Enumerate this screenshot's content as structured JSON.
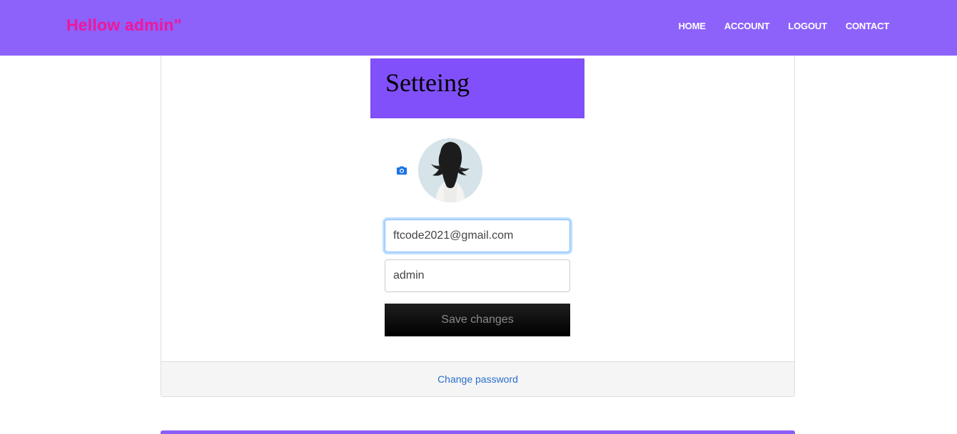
{
  "navbar": {
    "brand": "Hellow admin\"",
    "links": [
      {
        "label": "HOME"
      },
      {
        "label": "ACCOUNT"
      },
      {
        "label": "LOGOUT"
      },
      {
        "label": "CONTACT"
      }
    ],
    "background": "#8c62fb",
    "brand_color": "#f0179b"
  },
  "settings": {
    "title": "Setteing",
    "header_color": "#8250fa"
  },
  "profile": {
    "avatar_icon": "profile-photo",
    "upload_icon": "camera-icon",
    "upload_icon_color": "#1a73e8"
  },
  "form": {
    "email_value": "ftcode2021@gmail.com",
    "username_value": "admin",
    "save_label": "Save changes"
  },
  "footer": {
    "change_password_label": "Change password"
  }
}
